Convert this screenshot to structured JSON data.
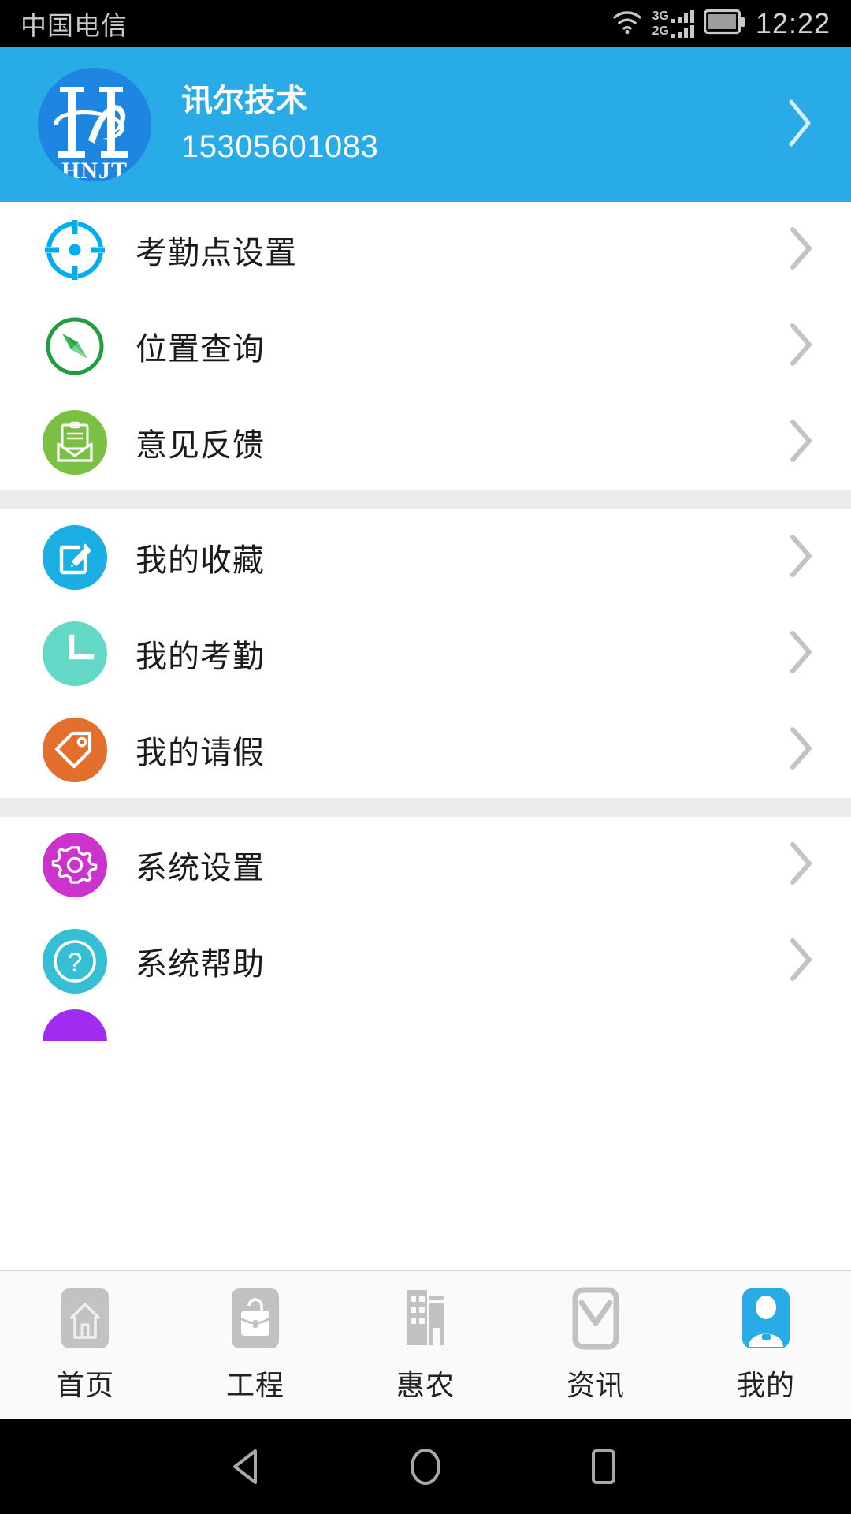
{
  "status_bar": {
    "carrier": "中国电信",
    "time": "12:22",
    "signal_labels": [
      "3G",
      "2G"
    ],
    "wifi_icon": "wifi-icon",
    "battery_icon": "battery-icon"
  },
  "profile": {
    "logo_text": "HNJT",
    "name": "讯尔技术",
    "phone": "15305601083",
    "chevron_icon": "chevron-right-icon",
    "background_color": "#29ABE8"
  },
  "menu_groups": [
    {
      "items": [
        {
          "label": "考勤点设置",
          "icon": "target-crosshair-icon",
          "color": "#00AEEF",
          "style": "outline"
        },
        {
          "label": "位置查询",
          "icon": "compass-icon",
          "color": "#1E9E3E",
          "style": "outline"
        },
        {
          "label": "意见反馈",
          "icon": "feedback-envelope-icon",
          "color": "#7AC143",
          "style": "filled"
        }
      ]
    },
    {
      "items": [
        {
          "label": "我的收藏",
          "icon": "edit-square-icon",
          "color": "#1BAEE3",
          "style": "filled"
        },
        {
          "label": "我的考勤",
          "icon": "clock-icon",
          "color": "#64D8C6",
          "style": "filled"
        },
        {
          "label": "我的请假",
          "icon": "tag-icon",
          "color": "#E2702C",
          "style": "filled"
        }
      ]
    },
    {
      "items": [
        {
          "label": "系统设置",
          "icon": "gear-icon",
          "color": "#CC33CC",
          "style": "filled"
        },
        {
          "label": "系统帮助",
          "icon": "question-circle-icon",
          "color": "#35BED4",
          "style": "filled"
        }
      ]
    }
  ],
  "row_chevron_icon": "chevron-right-icon",
  "tab_bar": {
    "active_index": 4,
    "active_color": "#29ABE8",
    "inactive_color": "#c2c2c2",
    "tabs": [
      {
        "label": "首页",
        "icon": "home-icon"
      },
      {
        "label": "工程",
        "icon": "briefcase-icon"
      },
      {
        "label": "惠农",
        "icon": "buildings-icon"
      },
      {
        "label": "资讯",
        "icon": "envelope-icon"
      },
      {
        "label": "我的",
        "icon": "person-icon"
      }
    ]
  },
  "nav_bar": {
    "back_icon": "back-triangle-icon",
    "home_icon": "home-circle-icon",
    "recents_icon": "recents-square-icon"
  }
}
